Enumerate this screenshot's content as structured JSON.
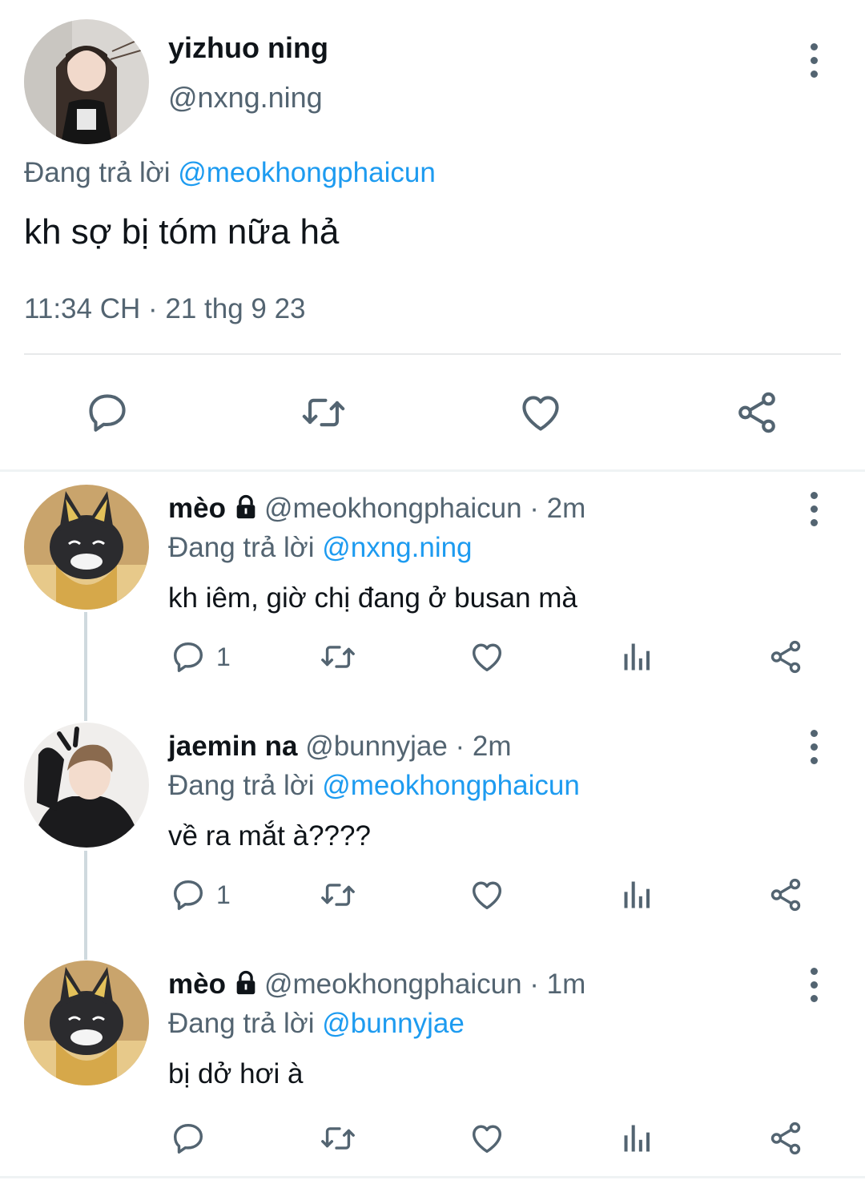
{
  "main": {
    "name": "yizhuo ning",
    "handle": "@nxng.ning",
    "replying_prefix": "Đang trả lời",
    "replying_to": "@meokhongphaicun",
    "text": "kh sợ bị tóm nữa hả",
    "timestamp": "11:34 CH · 21 thg 9 23",
    "actions": [
      "reply-icon",
      "retweet-icon",
      "like-icon",
      "share-icon"
    ]
  },
  "replies": [
    {
      "name": "mèo",
      "protected": true,
      "handle": "@meokhongphaicun",
      "time": "· 2m",
      "replying_prefix": "Đang trả lời",
      "replying_to": "@nxng.ning",
      "text": "kh iêm, giờ chị đang ở busan mà",
      "reply_count": "1"
    },
    {
      "name": "jaemin na",
      "protected": false,
      "handle": "@bunnyjae",
      "time": "· 2m",
      "replying_prefix": "Đang trả lời",
      "replying_to": "@meokhongphaicun",
      "text": "về ra mắt à????",
      "reply_count": "1"
    },
    {
      "name": "mèo",
      "protected": true,
      "handle": "@meokhongphaicun",
      "time": "· 1m",
      "replying_prefix": "Đang trả lời",
      "replying_to": "@bunnyjae",
      "text": "bị dở hơi à",
      "reply_count": ""
    }
  ],
  "colors": {
    "text": "#0f1419",
    "muted": "#536471",
    "link": "#1d9bf0",
    "divider": "#e7e9ea",
    "thread_line": "#cfd9de"
  }
}
